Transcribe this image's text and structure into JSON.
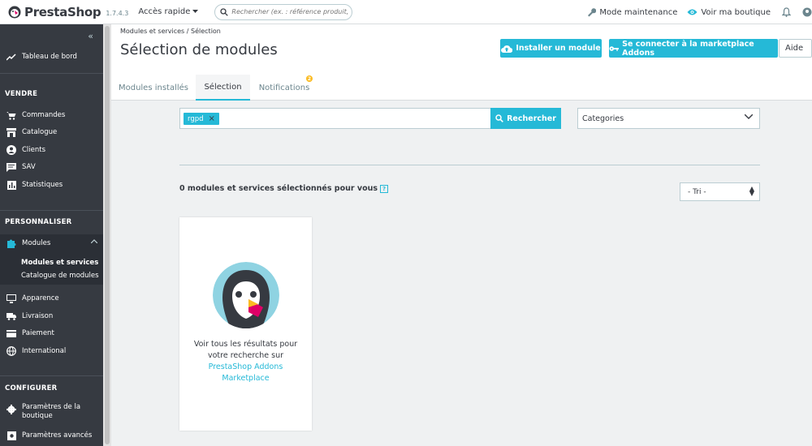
{
  "header": {
    "brand": "PrestaShop",
    "version": "1.7.4.3",
    "quick_access": "Accès rapide",
    "search_placeholder": "Rechercher (ex. : référence produit, nom",
    "maintenance": "Mode maintenance",
    "view_shop": "Voir ma boutique"
  },
  "sidebar": {
    "dashboard": "Tableau de bord",
    "section_sell": "VENDRE",
    "sell_items": [
      "Commandes",
      "Catalogue",
      "Clients",
      "SAV",
      "Statistiques"
    ],
    "section_customize": "PERSONNALISER",
    "modules": "Modules",
    "modules_sub": [
      "Modules et services",
      "Catalogue de modules"
    ],
    "customize_items": [
      "Apparence",
      "Livraison",
      "Paiement",
      "International"
    ],
    "section_configure": "CONFIGURER",
    "configure_items": [
      "Paramètres de la boutique",
      "Paramètres avancés"
    ]
  },
  "page": {
    "breadcrumb": "Modules et services  /  Sélection",
    "title": "Sélection de modules",
    "btn_install": "Installer un module",
    "btn_connect": "Se connecter à la marketplace Addons",
    "btn_help": "Aide",
    "tabs": [
      "Modules installés",
      "Sélection",
      "Notifications"
    ],
    "notif_count": "2"
  },
  "main": {
    "tag": "rgpd",
    "search_button": "Rechercher",
    "categories": "Categories",
    "count_text": "0 modules et services sélectionnés pour vous",
    "help_mark": "?",
    "sort": "- Tri -",
    "card_text": "Voir tous les résultats pour votre recherche sur",
    "card_link": "PrestaShop Addons Marketplace"
  },
  "colors": {
    "accent": "#25b9d7",
    "sidebar": "#363a41",
    "badge": "#fbbb22"
  }
}
